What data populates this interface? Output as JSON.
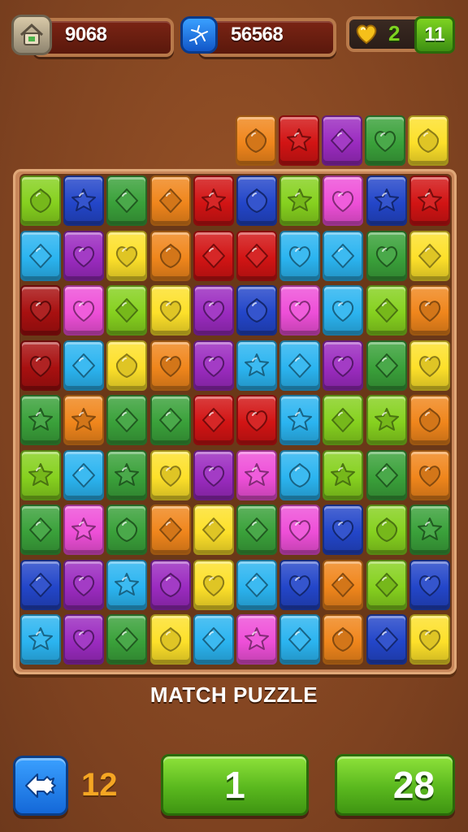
{
  "hud": {
    "left_value": "9068",
    "mid_value": "56568",
    "coin_count": "2",
    "plus_label": "11",
    "left_icon": "house-icon",
    "mid_icon": "crack-icon",
    "coin_icon": "gold-heart-coin-icon"
  },
  "colors": {
    "lime": "#86d11f",
    "navy": "#2346c9",
    "green": "#3aa13a",
    "orange": "#f0861c",
    "red": "#d21414",
    "yellow": "#fde02a",
    "pink": "#ee4fd8",
    "sky": "#2bb4f0",
    "darkred": "#a81010",
    "purple": "#9b2bc0"
  },
  "shape_names": {
    "shield": "shield-gem-icon",
    "star": "star-gem-icon",
    "diamond": "diamond-gem-icon",
    "heart": "heart-gem-icon"
  },
  "preview_row": [
    {
      "c": "orange",
      "s": "shield"
    },
    {
      "c": "red",
      "s": "star"
    },
    {
      "c": "purple",
      "s": "diamond"
    },
    {
      "c": "green",
      "s": "heart"
    },
    {
      "c": "yellow",
      "s": "shield"
    }
  ],
  "board": [
    [
      {
        "c": "lime",
        "s": "shield"
      },
      {
        "c": "navy",
        "s": "star"
      },
      {
        "c": "green",
        "s": "diamond"
      },
      {
        "c": "orange",
        "s": "diamond"
      },
      {
        "c": "red",
        "s": "star"
      },
      {
        "c": "navy",
        "s": "shield"
      },
      {
        "c": "lime",
        "s": "star"
      },
      {
        "c": "pink",
        "s": "heart"
      },
      {
        "c": "navy",
        "s": "star"
      },
      {
        "c": "red",
        "s": "star"
      }
    ],
    [
      {
        "c": "sky",
        "s": "diamond"
      },
      {
        "c": "purple",
        "s": "heart"
      },
      {
        "c": "yellow",
        "s": "heart"
      },
      {
        "c": "orange",
        "s": "shield"
      },
      {
        "c": "red",
        "s": "diamond"
      },
      {
        "c": "red",
        "s": "diamond"
      },
      {
        "c": "sky",
        "s": "heart"
      },
      {
        "c": "sky",
        "s": "diamond"
      },
      {
        "c": "green",
        "s": "heart"
      },
      {
        "c": "yellow",
        "s": "diamond"
      }
    ],
    [
      {
        "c": "darkred",
        "s": "heart"
      },
      {
        "c": "pink",
        "s": "heart"
      },
      {
        "c": "lime",
        "s": "diamond"
      },
      {
        "c": "yellow",
        "s": "heart"
      },
      {
        "c": "purple",
        "s": "heart"
      },
      {
        "c": "navy",
        "s": "shield"
      },
      {
        "c": "pink",
        "s": "heart"
      },
      {
        "c": "sky",
        "s": "heart"
      },
      {
        "c": "lime",
        "s": "diamond"
      },
      {
        "c": "orange",
        "s": "heart"
      }
    ],
    [
      {
        "c": "darkred",
        "s": "heart"
      },
      {
        "c": "sky",
        "s": "diamond"
      },
      {
        "c": "yellow",
        "s": "shield"
      },
      {
        "c": "orange",
        "s": "heart"
      },
      {
        "c": "purple",
        "s": "heart"
      },
      {
        "c": "sky",
        "s": "star"
      },
      {
        "c": "sky",
        "s": "diamond"
      },
      {
        "c": "purple",
        "s": "heart"
      },
      {
        "c": "green",
        "s": "diamond"
      },
      {
        "c": "yellow",
        "s": "heart"
      }
    ],
    [
      {
        "c": "green",
        "s": "star"
      },
      {
        "c": "orange",
        "s": "star"
      },
      {
        "c": "green",
        "s": "diamond"
      },
      {
        "c": "green",
        "s": "diamond"
      },
      {
        "c": "red",
        "s": "diamond"
      },
      {
        "c": "red",
        "s": "heart"
      },
      {
        "c": "sky",
        "s": "star"
      },
      {
        "c": "lime",
        "s": "diamond"
      },
      {
        "c": "lime",
        "s": "star"
      },
      {
        "c": "orange",
        "s": "shield"
      }
    ],
    [
      {
        "c": "lime",
        "s": "star"
      },
      {
        "c": "sky",
        "s": "diamond"
      },
      {
        "c": "green",
        "s": "star"
      },
      {
        "c": "yellow",
        "s": "heart"
      },
      {
        "c": "purple",
        "s": "heart"
      },
      {
        "c": "pink",
        "s": "star"
      },
      {
        "c": "sky",
        "s": "shield"
      },
      {
        "c": "lime",
        "s": "star"
      },
      {
        "c": "green",
        "s": "diamond"
      },
      {
        "c": "orange",
        "s": "heart"
      }
    ],
    [
      {
        "c": "green",
        "s": "diamond"
      },
      {
        "c": "pink",
        "s": "star"
      },
      {
        "c": "green",
        "s": "shield"
      },
      {
        "c": "orange",
        "s": "diamond"
      },
      {
        "c": "yellow",
        "s": "diamond"
      },
      {
        "c": "green",
        "s": "diamond"
      },
      {
        "c": "pink",
        "s": "heart"
      },
      {
        "c": "navy",
        "s": "heart"
      },
      {
        "c": "lime",
        "s": "shield"
      },
      {
        "c": "green",
        "s": "star"
      }
    ],
    [
      {
        "c": "navy",
        "s": "diamond"
      },
      {
        "c": "purple",
        "s": "heart"
      },
      {
        "c": "sky",
        "s": "star"
      },
      {
        "c": "purple",
        "s": "shield"
      },
      {
        "c": "yellow",
        "s": "heart"
      },
      {
        "c": "sky",
        "s": "diamond"
      },
      {
        "c": "navy",
        "s": "heart"
      },
      {
        "c": "orange",
        "s": "diamond"
      },
      {
        "c": "lime",
        "s": "diamond"
      },
      {
        "c": "navy",
        "s": "heart"
      }
    ],
    [
      {
        "c": "sky",
        "s": "star"
      },
      {
        "c": "purple",
        "s": "heart"
      },
      {
        "c": "green",
        "s": "diamond"
      },
      {
        "c": "yellow",
        "s": "shield"
      },
      {
        "c": "sky",
        "s": "diamond"
      },
      {
        "c": "pink",
        "s": "star"
      },
      {
        "c": "sky",
        "s": "diamond"
      },
      {
        "c": "orange",
        "s": "shield"
      },
      {
        "c": "navy",
        "s": "diamond"
      },
      {
        "c": "yellow",
        "s": "heart"
      }
    ]
  ],
  "title": "MATCH PUZZLE",
  "bottom": {
    "back_icon": "back-arrow-icon",
    "moves": "12",
    "level": "1",
    "score": "28"
  }
}
